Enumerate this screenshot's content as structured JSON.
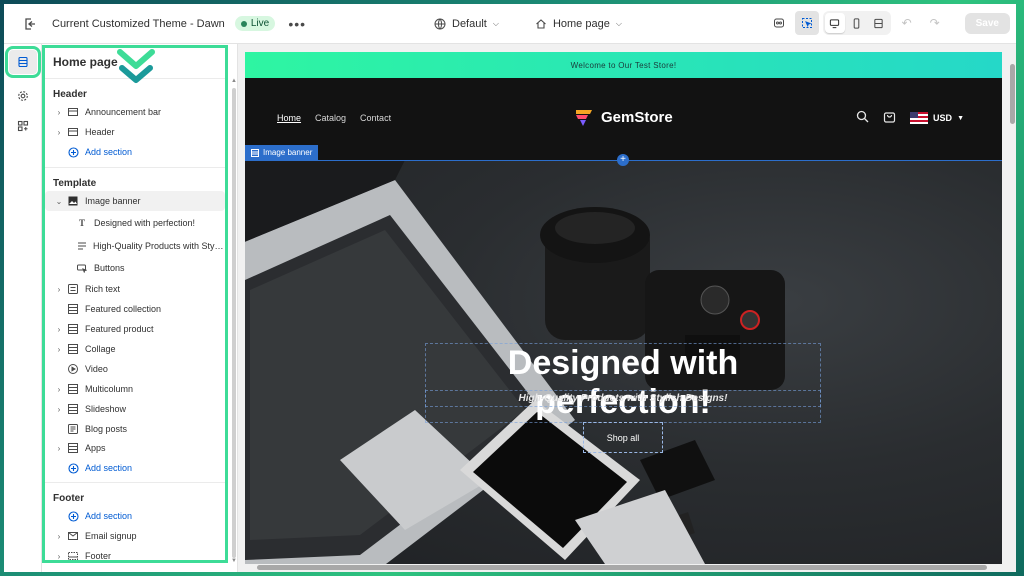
{
  "topbar": {
    "theme_name": "Current Customized Theme - Dawn",
    "live_badge": "Live",
    "template_select": "Default",
    "page_select": "Home page",
    "save_label": "Save"
  },
  "sidebar": {
    "title": "Home page",
    "header_group": "Header",
    "header_items": [
      "Announcement bar",
      "Header"
    ],
    "add_section": "Add section",
    "template_group": "Template",
    "image_banner": "Image banner",
    "banner_blocks": [
      "Designed with perfection!",
      "High-Quality Products with Stylish Designs!",
      "Buttons"
    ],
    "template_items": [
      "Rich text",
      "Featured collection",
      "Featured product",
      "Collage",
      "Video",
      "Multicolumn",
      "Slideshow",
      "Blog posts",
      "Apps"
    ],
    "footer_group": "Footer",
    "footer_items": [
      "Email signup",
      "Footer"
    ]
  },
  "preview": {
    "announcement": "Welcome to Our Test Store!",
    "nav": [
      "Home",
      "Catalog",
      "Contact"
    ],
    "logo": "GemStore",
    "currency": "USD",
    "banner_tag": "Image banner",
    "hero_title": "Designed with perfection!",
    "hero_subtitle": "High-Quality Products with Stylish Designs!",
    "hero_button": "Shop all"
  },
  "colors": {
    "accent": "#005bd3",
    "highlight": "#3ddc97",
    "live": "#29845a",
    "announce_start": "#2ef5a2",
    "announce_end": "#25d8c8"
  }
}
